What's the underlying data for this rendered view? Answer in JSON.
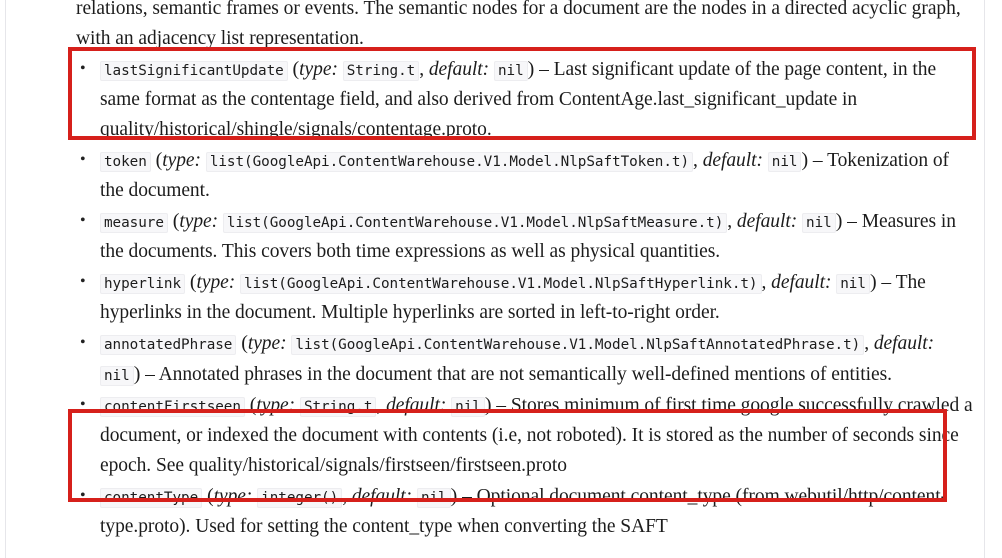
{
  "page": {
    "accent_highlight_color": "#d6201b",
    "background_color": "#ffffff",
    "text_color": "#1c1c1c",
    "code_background_color": "#f7f7f9"
  },
  "intro_paragraph": {
    "line_1": "relations, semantic frames or events. The semantic nodes for a document are the nodes in a directed",
    "line_2": "acyclic graph, with an adjacency list representation."
  },
  "labels": {
    "type_label": "type:",
    "default_label": "default:",
    "open_paren": "(",
    "close_paren": ")",
    "comma": ",",
    "dash": "–"
  },
  "fields": [
    {
      "name": "lastSignificantUpdate",
      "type": "String.t",
      "default": "nil",
      "description": "Last significant update of the page content, in the same format as the contentage field, and also derived from ContentAge.last_significant_update in quality/historical/shingle/signals/contentage.proto.",
      "highlighted": true
    },
    {
      "name": "token",
      "type": "list(GoogleApi.ContentWarehouse.V1.Model.NlpSaftToken.t)",
      "default": "nil",
      "description": "Tokenization of the document.",
      "highlighted": false
    },
    {
      "name": "measure",
      "type": "list(GoogleApi.ContentWarehouse.V1.Model.NlpSaftMeasure.t)",
      "default": "nil",
      "description": "Measures in the documents. This covers both time expressions as well as physical quantities.",
      "highlighted": false
    },
    {
      "name": "hyperlink",
      "type": "list(GoogleApi.ContentWarehouse.V1.Model.NlpSaftHyperlink.t)",
      "default": "nil",
      "description": "The hyperlinks in the document. Multiple hyperlinks are sorted in left-to-right order.",
      "highlighted": false
    },
    {
      "name": "annotatedPhrase",
      "type": "list(GoogleApi.ContentWarehouse.V1.Model.NlpSaftAnnotatedPhrase.t)",
      "default": "nil",
      "description": "Annotated phrases in the document that are not semantically well-defined mentions of entities.",
      "highlighted": false
    },
    {
      "name": "contentFirstseen",
      "type": "String.t",
      "default": "nil",
      "description": "Stores minimum of first time google successfully crawled a document, or indexed the document with contents (i.e, not roboted). It is stored as the number of seconds since epoch. See quality/historical/signals/firstseen/firstseen.proto",
      "highlighted": true
    },
    {
      "name": "contentType",
      "type": "integer()",
      "default": "nil",
      "description": "Optional document content_type (from webutil/http/content-type.proto). Used for setting the content_type when converting the SAFT",
      "highlighted": false
    }
  ],
  "annotations": [
    {
      "id": "hl-box-1",
      "target_field": "lastSignificantUpdate",
      "color": "#d6201b"
    },
    {
      "id": "hl-box-2",
      "target_field": "contentFirstseen",
      "color": "#d6201b"
    }
  ]
}
